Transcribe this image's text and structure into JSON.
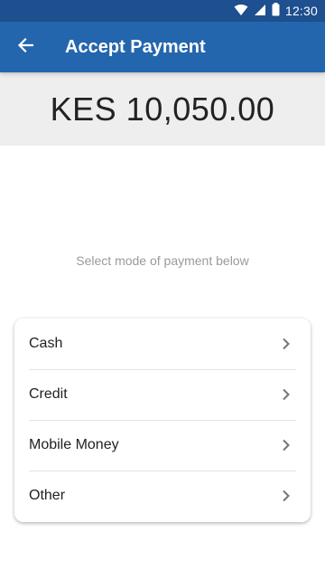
{
  "status_bar": {
    "time": "12:30",
    "icons": [
      "wifi-icon",
      "signal-icon",
      "battery-icon"
    ]
  },
  "app_bar": {
    "title": "Accept Payment",
    "back_icon": "arrow-left-icon"
  },
  "amount": {
    "text": "KES 10,050.00"
  },
  "hint": {
    "text": "Select mode of payment below"
  },
  "payment_options": [
    {
      "label": "Cash",
      "icon": "chevron-right-icon"
    },
    {
      "label": "Credit",
      "icon": "chevron-right-icon"
    },
    {
      "label": "Mobile Money",
      "icon": "chevron-right-icon"
    },
    {
      "label": "Other",
      "icon": "chevron-right-icon"
    }
  ],
  "colors": {
    "status_bar": "#1e4f8e",
    "app_bar": "#2466ad",
    "amount_panel": "#eeeeee",
    "hint_text": "#9a9a9a"
  }
}
